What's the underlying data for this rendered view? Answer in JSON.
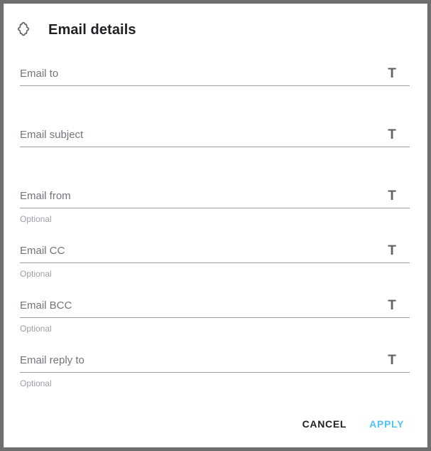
{
  "dialog": {
    "title": "Email details",
    "icon": "puzzle-piece-icon"
  },
  "fields": [
    {
      "label": "Email to",
      "hint": "",
      "type_icon": "T",
      "type_icon_name": "text-type-icon"
    },
    {
      "label": "Email subject",
      "hint": "",
      "type_icon": "T",
      "type_icon_name": "text-type-icon"
    },
    {
      "label": "Email from",
      "hint": "Optional",
      "type_icon": "T",
      "type_icon_name": "text-type-icon"
    },
    {
      "label": "Email CC",
      "hint": "Optional",
      "type_icon": "T",
      "type_icon_name": "text-type-icon"
    },
    {
      "label": "Email BCC",
      "hint": "Optional",
      "type_icon": "T",
      "type_icon_name": "text-type-icon"
    },
    {
      "label": "Email reply to",
      "hint": "Optional",
      "type_icon": "T",
      "type_icon_name": "text-type-icon"
    }
  ],
  "footer": {
    "cancel_label": "CANCEL",
    "apply_label": "APPLY"
  },
  "colors": {
    "accent": "#4fc3f7",
    "text_primary": "#202124",
    "text_secondary": "#70757a",
    "hint": "#9aa0a6",
    "underline": "#9aa0a6",
    "backdrop": "#6e6e6e",
    "surface": "#ffffff"
  }
}
